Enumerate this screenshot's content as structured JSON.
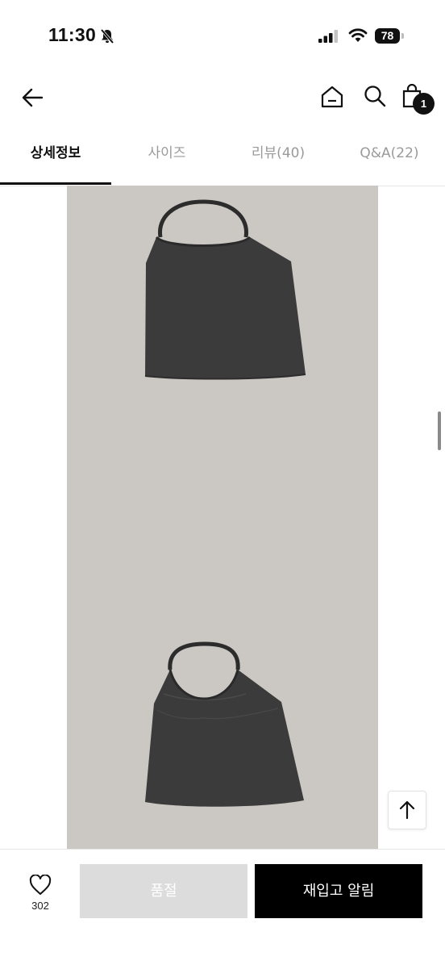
{
  "status_bar": {
    "time": "11:30",
    "battery": "78"
  },
  "header": {
    "back_icon": "arrow-left-icon",
    "home_icon": "home-icon",
    "search_icon": "search-icon",
    "cart_icon": "shopping-bag-icon",
    "cart_count": "1"
  },
  "tabs": [
    {
      "label": "상세정보",
      "active": true
    },
    {
      "label": "사이즈",
      "active": false
    },
    {
      "label": "리뷰(40)",
      "active": false
    },
    {
      "label": "Q&A(22)",
      "active": false
    }
  ],
  "bottom_bar": {
    "like_icon": "heart-icon",
    "like_count": "302",
    "soldout_label": "품절",
    "restock_label": "재입고 알림"
  },
  "colors": {
    "image_background": "#cbc8c3",
    "garment": "#3a3a3a",
    "primary_button": "#000000",
    "disabled_button": "#dcdcdc"
  }
}
